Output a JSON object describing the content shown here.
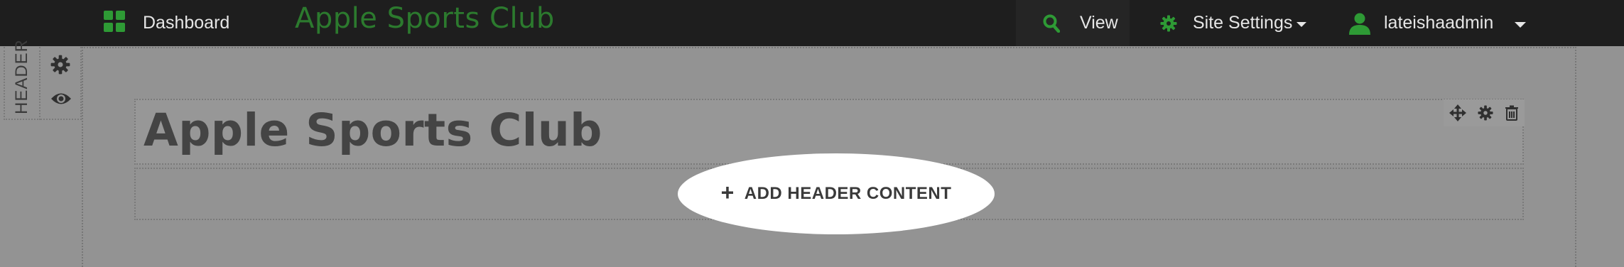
{
  "topbar": {
    "dashboard_label": "Dashboard",
    "site_title": "Apple Sports Club",
    "view_label": "View",
    "site_settings_label": "Site Settings",
    "username": "lateishaadmin"
  },
  "sidebar": {
    "section_label": "HEADER"
  },
  "header_row": {
    "title": "Apple Sports Club"
  },
  "add_content": {
    "label": "ADD HEADER CONTENT"
  },
  "icons": {
    "dashboard": "grid-icon",
    "view": "search-icon",
    "site_settings": "gear-icon",
    "user": "user-icon",
    "section_settings": "gear-icon",
    "section_visibility": "eye-icon",
    "row_move": "move-icon",
    "row_settings": "gear-icon",
    "row_delete": "trash-icon",
    "add": "plus-icon"
  },
  "colors": {
    "accent_green": "#2e9a35",
    "topbar_bg": "#1e1e1e",
    "canvas_bg": "#939393"
  }
}
